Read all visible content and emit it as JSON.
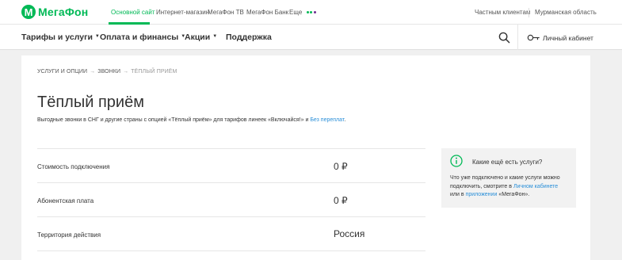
{
  "brand": {
    "mark": "M",
    "name": "МегаФон",
    "accent": "#00b956"
  },
  "topbar": {
    "links": [
      "Основной сайт",
      "Интернет-магазин",
      "МегаФон ТВ",
      "МегаФон Банк",
      "Еще"
    ],
    "more_dot_colors": [
      "#00b956",
      "#00b956",
      "#6f2c91"
    ],
    "client_type": "Частным клиентам",
    "region": "Мурманская область"
  },
  "nav": {
    "items": [
      "Тарифы и услуги",
      "Оплата и финансы",
      "Акции",
      "Поддержка"
    ],
    "search_icon": "search-icon",
    "cabinet_label": "Личный кабинет",
    "cabinet_icon": "key-icon"
  },
  "breadcrumb": [
    "УСЛУГИ И ОПЦИИ",
    "ЗВОНКИ",
    "ТЁПЛЫЙ ПРИЁМ"
  ],
  "breadcrumb_separator": "→",
  "page": {
    "title": "Тёплый приём",
    "description_text": "Выгодные звонки в СНГ и другие страны с опцией «Тёплый приём» для тарифов линеек «Включайся!» и",
    "description_link": "Без переплат",
    "description_end": "."
  },
  "params": [
    {
      "label": "Стоимость подключения",
      "value": "0 ₽"
    },
    {
      "label": "Абонентская плата",
      "value": "0 ₽"
    },
    {
      "label": "Территория действия",
      "value": "Россия"
    }
  ],
  "infobox": {
    "icon": "info-icon",
    "title": "Какие ещё есть услуги?",
    "text_1": "Что уже подключено и какие услуги можно подключить, смотрите в",
    "link_1": "Личном кабинете",
    "text_2": "или в",
    "link_2": "приложении",
    "text_3": "«МегаФон».",
    "link_color": "#2a8fd8"
  }
}
